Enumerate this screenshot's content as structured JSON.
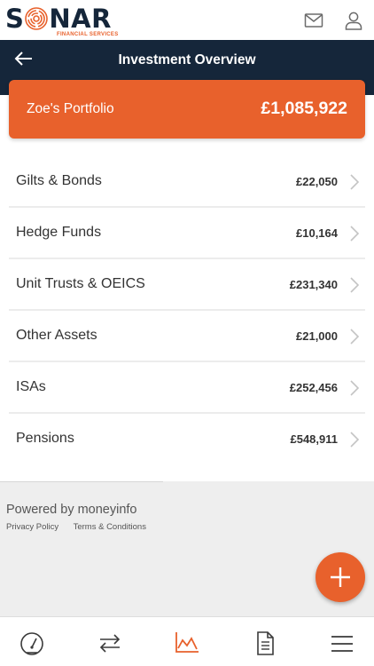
{
  "brand": {
    "name_part1": "S",
    "name_part2": "NAR",
    "tagline": "FINANCIAL SERVICES"
  },
  "header": {
    "icons": [
      "mail-icon",
      "user-icon"
    ]
  },
  "titlebar": {
    "title": "Investment Overview",
    "back_icon": "back-arrow-icon"
  },
  "portfolio": {
    "name": "Zoe's Portfolio",
    "total": "£1,085,922"
  },
  "investments": [
    {
      "label": "Gilts & Bonds",
      "value": "£22,050"
    },
    {
      "label": "Hedge Funds",
      "value": "£10,164"
    },
    {
      "label": "Unit Trusts & OEICS",
      "value": "£231,340"
    },
    {
      "label": "Other Assets",
      "value": "£21,000"
    },
    {
      "label": "ISAs",
      "value": "£252,456"
    },
    {
      "label": "Pensions",
      "value": "£548,911"
    }
  ],
  "footer": {
    "powered_by": "Powered by moneyinfo",
    "privacy": "Privacy Policy",
    "terms": "Terms & Conditions"
  },
  "bottom_nav": [
    "dashboard-icon",
    "transfer-icon",
    "chart-icon",
    "document-icon",
    "menu-icon"
  ],
  "colors": {
    "accent": "#e8612c",
    "navy": "#15263a",
    "footer_bg": "#eeeeee"
  }
}
